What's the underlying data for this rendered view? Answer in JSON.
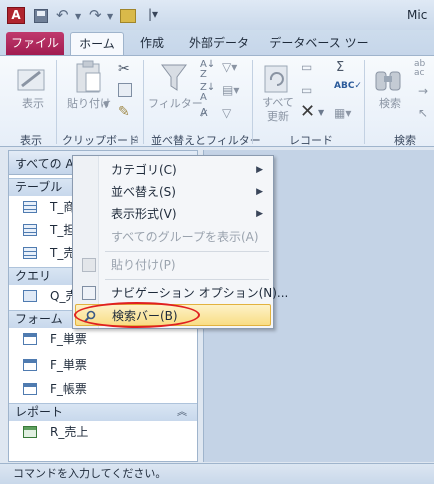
{
  "window": {
    "title_partial": "Mic",
    "app_icon_letter": "A"
  },
  "tabs": {
    "file": "ファイル",
    "items": [
      "ホーム",
      "作成",
      "外部データ",
      "データベース ツール"
    ],
    "active": "ホーム"
  },
  "ribbon": {
    "view_label": "表示",
    "paste_label": "貼り付け",
    "filter_label": "フィルター",
    "refresh_label": "すべて\n更新",
    "find_label": "検索",
    "groups": [
      "表示",
      "クリップボード",
      "並べ替えとフィルター",
      "レコード",
      "検索"
    ]
  },
  "nav": {
    "header": "すべての Ac",
    "groups": {
      "tables": "テーブル",
      "queries": "クエリ",
      "forms": "フォーム",
      "reports": "レポート"
    },
    "items": {
      "tables": [
        "T_商",
        "T_担",
        "T_売"
      ],
      "queries": [
        "Q_売"
      ],
      "forms": [
        "F_単票",
        "F_単票",
        "F_帳票"
      ],
      "reports": [
        "R_売上"
      ]
    }
  },
  "context_menu": {
    "items": [
      {
        "label": "カテゴリ(C)",
        "submenu": true,
        "enabled": true
      },
      {
        "label": "並べ替え(S)",
        "submenu": true,
        "enabled": true
      },
      {
        "label": "表示形式(V)",
        "submenu": true,
        "enabled": true
      },
      {
        "label": "すべてのグループを表示(A)",
        "submenu": false,
        "enabled": false
      },
      {
        "label": "貼り付け(P)",
        "submenu": false,
        "enabled": false
      },
      {
        "label": "ナビゲーション オプション(N)...",
        "submenu": false,
        "enabled": true
      },
      {
        "label": "検索バー(B)",
        "submenu": false,
        "enabled": true,
        "highlighted": true
      }
    ]
  },
  "status": {
    "text": "コマンドを入力してください。"
  },
  "colors": {
    "file_tab": "#a11c50",
    "highlight": "#f9dd85",
    "annotation": "#e02020"
  }
}
